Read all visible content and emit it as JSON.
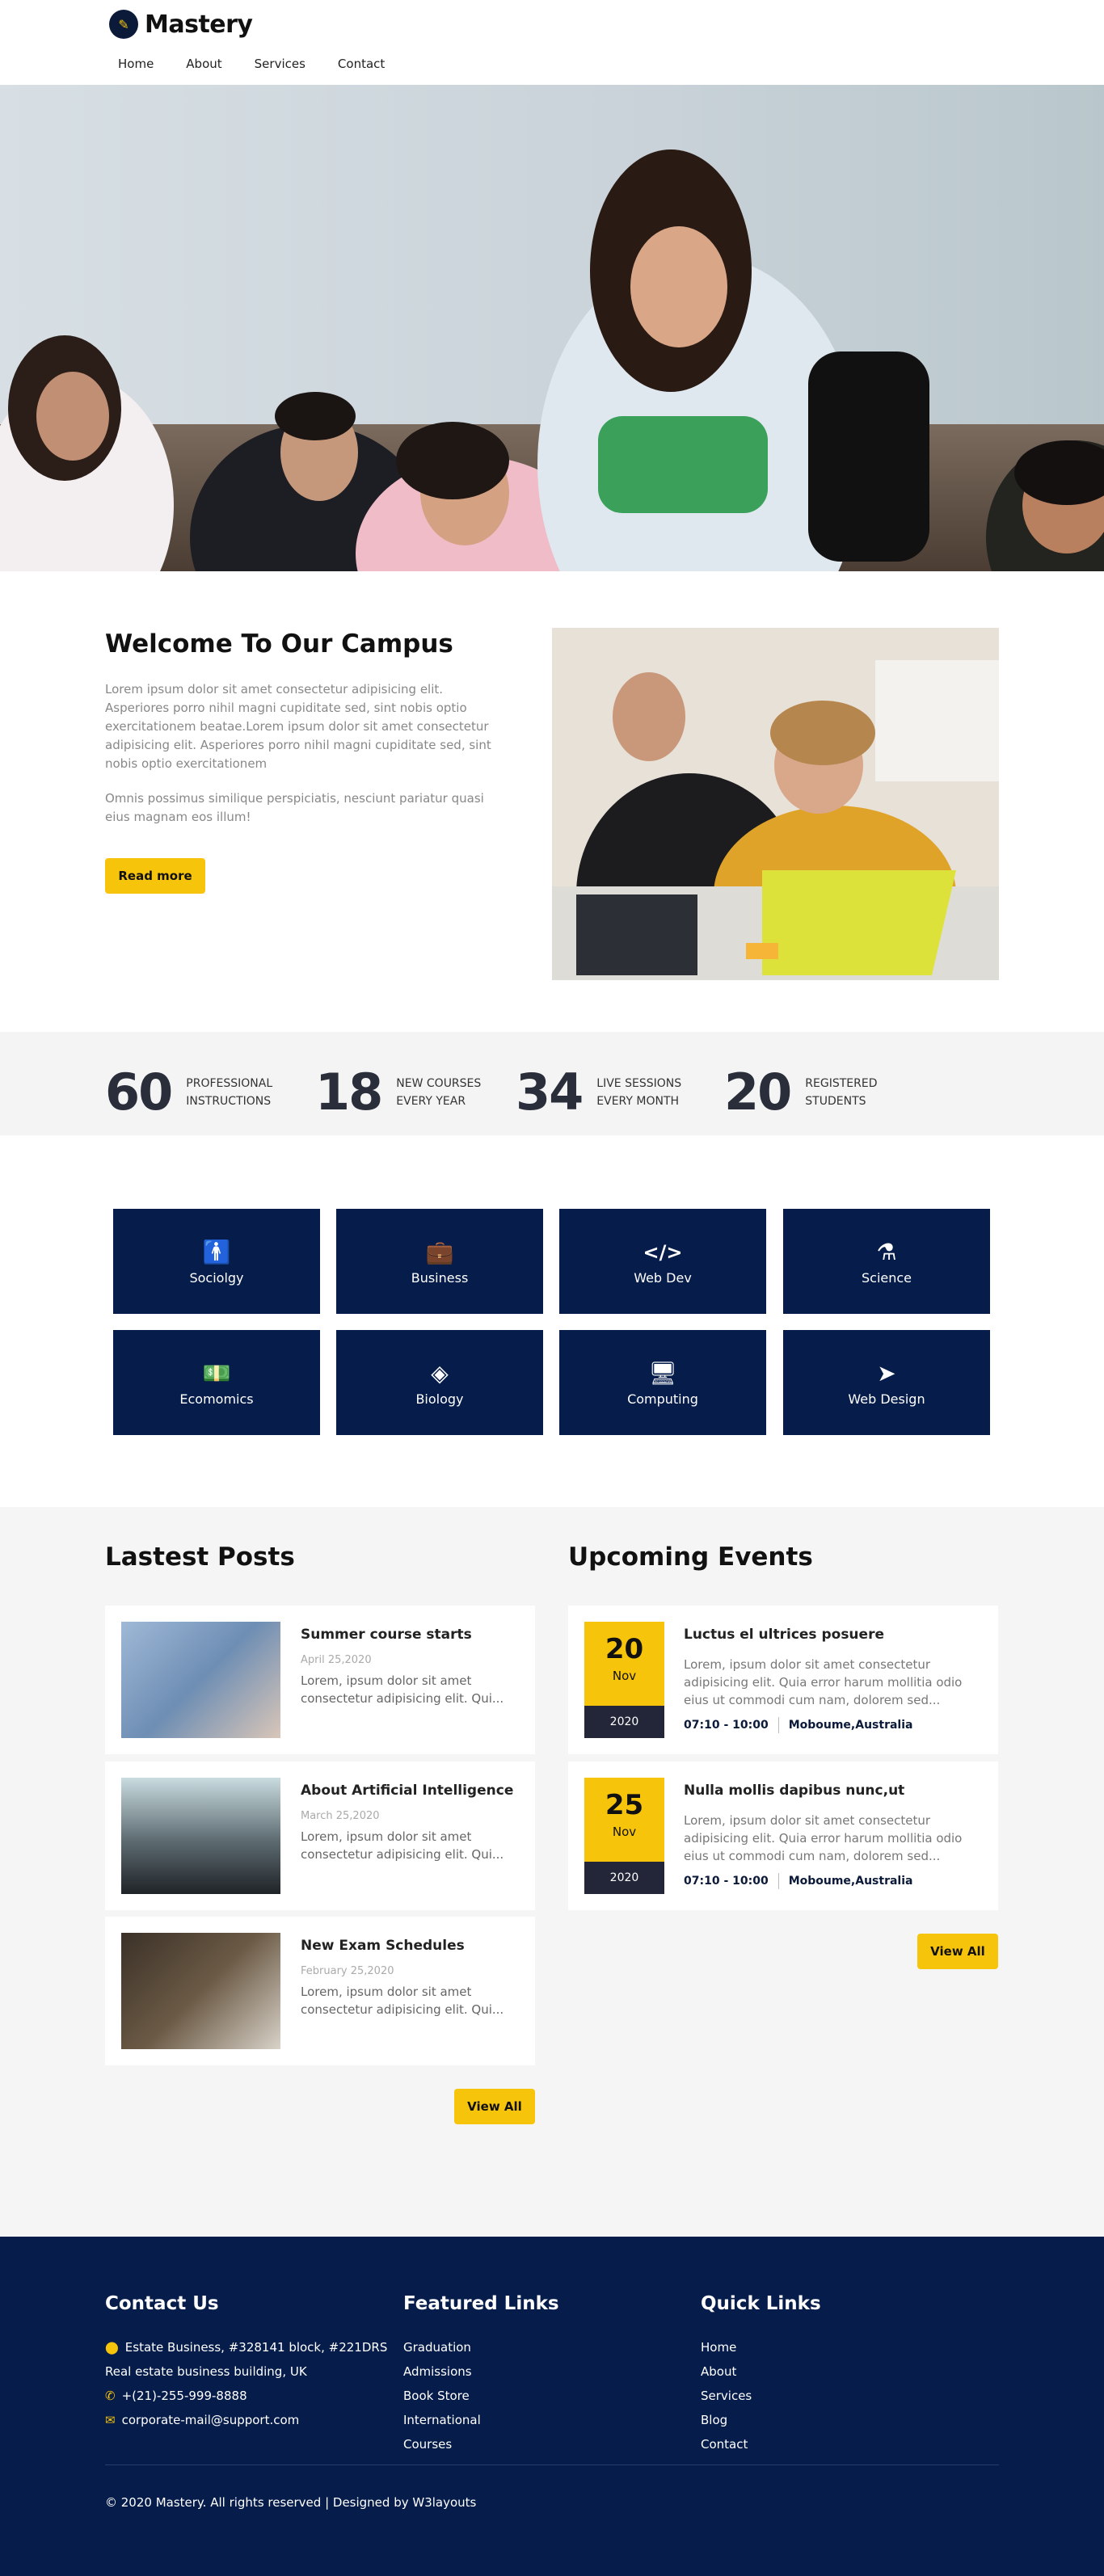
{
  "brand": {
    "name": "Mastery"
  },
  "nav": [
    "Home",
    "About",
    "Services",
    "Contact"
  ],
  "welcome": {
    "title": "Welcome To Our Campus",
    "para1": "Lorem ipsum dolor sit amet consectetur adipisicing elit. Asperiores porro nihil magni cupiditate sed, sint nobis optio exercitationem beatae.Lorem ipsum dolor sit amet consectetur adipisicing elit. Asperiores porro nihil magni cupiditate sed, sint nobis optio exercitationem",
    "para2": "Omnis possimus similique perspiciatis, nesciunt pariatur quasi eius magnam eos illum!",
    "button": "Read more"
  },
  "stats": [
    {
      "num": "60",
      "line1": "Professional",
      "line2": "Instructions"
    },
    {
      "num": "18",
      "line1": "New Courses",
      "line2": "Every Year"
    },
    {
      "num": "34",
      "line1": "Live Sessions",
      "line2": "Every Month"
    },
    {
      "num": "20",
      "line1": "Registered",
      "line2": "Students"
    }
  ],
  "categories": [
    {
      "label": "Sociolgy",
      "icon": "person-icon"
    },
    {
      "label": "Business",
      "icon": "briefcase-icon"
    },
    {
      "label": "Web Dev",
      "icon": "code-icon"
    },
    {
      "label": "Science",
      "icon": "flask-icon"
    },
    {
      "label": "Ecomomics",
      "icon": "money-icon"
    },
    {
      "label": "Biology",
      "icon": "diamond-icon"
    },
    {
      "label": "Computing",
      "icon": "monitor-icon"
    },
    {
      "label": "Web Design",
      "icon": "pointer-icon"
    }
  ],
  "posts": {
    "heading": "Lastest Posts",
    "items": [
      {
        "title": "Summer course starts",
        "date": "April 25,2020",
        "excerpt": "Lorem, ipsum dolor sit amet consectetur adipisicing elit. Qui..."
      },
      {
        "title": "About Artificial Intelligence",
        "date": "March 25,2020",
        "excerpt": "Lorem, ipsum dolor sit amet consectetur adipisicing elit. Qui..."
      },
      {
        "title": "New Exam Schedules",
        "date": "February 25,2020",
        "excerpt": "Lorem, ipsum dolor sit amet consectetur adipisicing elit. Qui..."
      }
    ],
    "view_all": "View All"
  },
  "events": {
    "heading": "Upcoming Events",
    "items": [
      {
        "day": "20",
        "month": "Nov",
        "year": "2020",
        "title": "Luctus el ultrices posuere",
        "excerpt": "Lorem, ipsum dolor sit amet consectetur adipisicing elit. Quia error harum mollitia odio eius ut commodi cum nam, dolorem sed...",
        "time": "07:10 - 10:00",
        "place": "Moboume,Australia"
      },
      {
        "day": "25",
        "month": "Nov",
        "year": "2020",
        "title": "Nulla mollis dapibus nunc,ut",
        "excerpt": "Lorem, ipsum dolor sit amet consectetur adipisicing elit. Quia error harum mollitia odio eius ut commodi cum nam, dolorem sed...",
        "time": "07:10 - 10:00",
        "place": "Moboume,Australia"
      }
    ],
    "view_all": "View All"
  },
  "footer": {
    "contact": {
      "heading": "Contact Us",
      "address1": "Estate Business, #328141 block, #221DRS",
      "address2": "Real estate business building, UK",
      "phone": "+(21)-255-999-8888",
      "email": "corporate-mail@support.com"
    },
    "featured": {
      "heading": "Featured Links",
      "items": [
        "Graduation",
        "Admissions",
        "Book Store",
        "International",
        "Courses"
      ]
    },
    "quick": {
      "heading": "Quick Links",
      "items": [
        "Home",
        "About",
        "Services",
        "Blog",
        "Contact"
      ]
    },
    "copyright": "© 2020 Mastery. All rights reserved | Designed by W3layouts"
  },
  "colors": {
    "accent": "#f7c40c",
    "navy": "#061c4a"
  }
}
